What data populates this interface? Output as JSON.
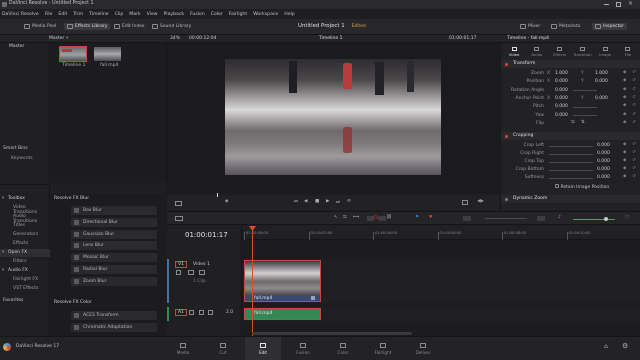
{
  "titlebar": {
    "title": "DaVinci Resolve - Untitled Project 1"
  },
  "menu": [
    "DaVinci Resolve",
    "File",
    "Edit",
    "Trim",
    "Timeline",
    "Clip",
    "Mark",
    "View",
    "Playback",
    "Fusion",
    "Color",
    "Fairlight",
    "Workspace",
    "Help"
  ],
  "toolbar": {
    "media_pool": "Media Pool",
    "effects_library": "Effects Library",
    "edit_index": "Edit Index",
    "sound_library": "Sound Library",
    "project_name": "Untitled Project 1",
    "project_status": "Edited",
    "mixer": "Mixer",
    "metadata": "Metadata",
    "inspector": "Inspector"
  },
  "viewer_bar": {
    "bin": "Master",
    "zoom": "34%",
    "timecode": "00:00:12:04",
    "timeline_name": "Timeline 1",
    "record_timecode": "01:00:01:17"
  },
  "bins": {
    "master": "Master",
    "smart_bins": "Smart Bins",
    "keywords": "Keywords"
  },
  "media_pool_clips": [
    {
      "label": "Timeline 1"
    },
    {
      "label": "fall.mp4"
    }
  ],
  "inspector": {
    "title": "Timeline - fall.mp4",
    "tabs": [
      "Video",
      "Audio",
      "Effects",
      "Transition",
      "Image",
      "File"
    ],
    "transform": {
      "header": "Transform",
      "rows": [
        {
          "label": "Zoom",
          "x_label": "X",
          "x": "1.000",
          "y_label": "Y",
          "y": "1.000"
        },
        {
          "label": "Position",
          "x_label": "X",
          "x": "0.000",
          "y_label": "Y",
          "y": "0.000"
        },
        {
          "label": "Rotation Angle",
          "x": "0.000"
        },
        {
          "label": "Anchor Point",
          "x_label": "X",
          "x": "0.000",
          "y_label": "Y",
          "y": "0.000"
        },
        {
          "label": "Pitch",
          "x": "0.000"
        },
        {
          "label": "Yaw",
          "x": "0.000"
        },
        {
          "label": "Flip"
        }
      ]
    },
    "cropping": {
      "header": "Cropping",
      "rows": [
        {
          "label": "Crop Left",
          "value": "0.000"
        },
        {
          "label": "Crop Right",
          "value": "0.000"
        },
        {
          "label": "Crop Top",
          "value": "0.000"
        },
        {
          "label": "Crop Bottom",
          "value": "0.000"
        },
        {
          "label": "Softness",
          "value": "0.000"
        }
      ],
      "retain": "Retain Image Position"
    },
    "dynamic_zoom": "Dynamic Zoom"
  },
  "toolbox": {
    "items": [
      {
        "label": "Toolbox",
        "level": 0
      },
      {
        "label": "Video Transitions",
        "level": 1
      },
      {
        "label": "Audio Transitions",
        "level": 1
      },
      {
        "label": "Titles",
        "level": 1
      },
      {
        "label": "Generators",
        "level": 1
      },
      {
        "label": "Effects",
        "level": 1
      },
      {
        "label": "Open FX",
        "level": 0,
        "selected": true
      },
      {
        "label": "Filters",
        "level": 1
      },
      {
        "label": "Audio FX",
        "level": 0
      },
      {
        "label": "Fairlight FX",
        "level": 1
      },
      {
        "label": "VST Effects",
        "level": 1
      }
    ],
    "favorites": "Favorites"
  },
  "fx_list": {
    "group1": "Resolve FX Blur",
    "items1": [
      "Box Blur",
      "Directional Blur",
      "Gaussian Blur",
      "Lens Blur",
      "Mosaic Blur",
      "Radial Blur",
      "Zoom Blur"
    ],
    "group2": "Resolve FX Color",
    "items2": [
      "ACES Transform",
      "Chromatic Adaptation"
    ]
  },
  "timeline": {
    "timecode": "01:00:01:17",
    "ruler": [
      "01:00:00:00",
      "01:00:02:00",
      "01:00:04:00",
      "01:00:06:00",
      "01:00:08:00",
      "01:00:10:00"
    ],
    "video_track": {
      "id": "V1",
      "name": "Video 1",
      "clip_count": "1 Clip",
      "clip_label": "fall.mp4"
    },
    "audio_track": {
      "id": "A1",
      "level": "2.0",
      "clip_label": "fall.mp4"
    }
  },
  "pages": [
    {
      "label": "Media",
      "active": false
    },
    {
      "label": "Cut",
      "active": false
    },
    {
      "label": "Edit",
      "active": true
    },
    {
      "label": "Fusion",
      "active": false
    },
    {
      "label": "Color",
      "active": false
    },
    {
      "label": "Fairlight",
      "active": false
    },
    {
      "label": "Deliver",
      "active": false
    }
  ],
  "app_name": "DaVinci Resolve 17",
  "colors": {
    "accent": "#d4453a",
    "blue": "#3a7fd4",
    "audio_clip": "#2f8a56",
    "video_clip": "#4b6ea8",
    "playhead": "#e04a30"
  }
}
